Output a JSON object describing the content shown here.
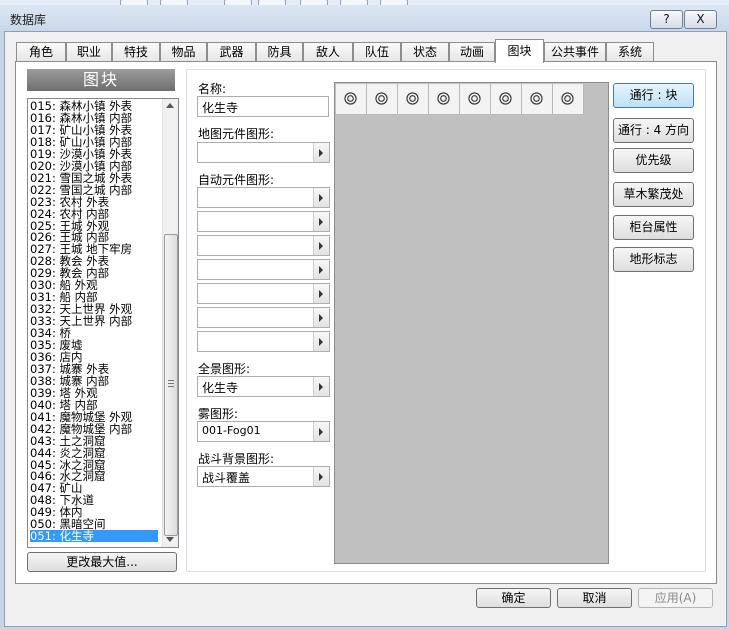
{
  "window": {
    "title": "数据库",
    "help_label": "?",
    "close_label": "X"
  },
  "tabs": [
    "角色",
    "职业",
    "特技",
    "物品",
    "武器",
    "防具",
    "敌人",
    "队伍",
    "状态",
    "动画",
    "图块",
    "公共事件",
    "系统"
  ],
  "active_tab": 10,
  "tileset_list": {
    "header": "图块",
    "items": [
      "015: 森林小镇 外表",
      "016: 森林小镇 内部",
      "017: 矿山小镇 外表",
      "018: 矿山小镇 内部",
      "019: 沙漠小镇 外表",
      "020: 沙漠小镇 内部",
      "021: 雪国之城 外表",
      "022: 雪国之城 内部",
      "023: 农村 外表",
      "024: 农村 内部",
      "025: 王城 外观",
      "026: 王城 内部",
      "027: 王城 地下牢房",
      "028: 教会 外表",
      "029: 教会 内部",
      "030: 船 外观",
      "031: 船 内部",
      "032: 天上世界 外观",
      "033: 天上世界 内部",
      "034: 桥",
      "035: 废墟",
      "036: 店内",
      "037: 城寨 外表",
      "038: 城寨 内部",
      "039: 塔 外观",
      "040: 塔 内部",
      "041: 魔物城堡 外观",
      "042: 魔物城堡 内部",
      "043: 土之洞窟",
      "044: 炎之洞窟",
      "045: 冰之洞窟",
      "046: 水之洞窟",
      "047: 矿山",
      "048: 下水道",
      "049: 体内",
      "050: 黑暗空间",
      "051: 化生寺"
    ],
    "selected_index": 36,
    "change_max_label": "更改最大值..."
  },
  "form": {
    "name_label": "名称:",
    "name_value": "化生寺",
    "tileset_graphic_label": "地图元件图形:",
    "tileset_graphic_value": "",
    "autotile_label": "自动元件图形:",
    "autotiles": [
      "",
      "",
      "",
      "",
      "",
      "",
      ""
    ],
    "panorama_label": "全景图形:",
    "panorama_value": "化生寺",
    "fog_label": "雾图形:",
    "fog_value": "001-Fog01",
    "battleback_label": "战斗背景图形:",
    "battleback_value": "战斗覆盖"
  },
  "palette": {
    "cell_count": 8,
    "cell_symbol": "passable-circle-icon"
  },
  "side_buttons": [
    "通行 : 块",
    "通行 : 4 方向",
    "优先级",
    "草木繁茂处",
    "柜台属性",
    "地形标志"
  ],
  "footer": {
    "ok_label": "确定",
    "cancel_label": "取消",
    "apply_label": "应用(A)"
  }
}
